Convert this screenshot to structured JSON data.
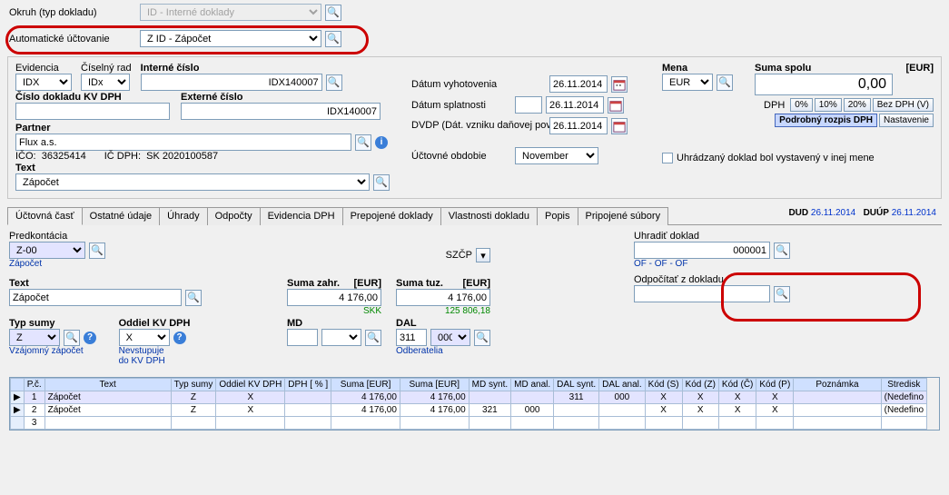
{
  "top": {
    "okruh_label": "Okruh (typ dokladu)",
    "okruh_value": "ID - Interné doklady",
    "auto_uct_label": "Automatické účtovanie",
    "auto_uct_value": "Z ID - Zápočet"
  },
  "header": {
    "evidencia_label": "Evidencia",
    "evidencia_value": "IDX",
    "ciselny_rad_label": "Číselný rad",
    "ciselny_rad_value": "IDx",
    "interne_cislo_label": "Interné číslo",
    "interne_cislo_value": "IDX140007",
    "cislo_dokladu_kvdph_label": "Číslo dokladu KV DPH",
    "cislo_dokladu_kvdph_value": "",
    "externe_cislo_label": "Externé číslo",
    "externe_cislo_value": "IDX140007",
    "partner_label": "Partner",
    "partner_value": "Flux a.s.",
    "ico_label": "IČO:",
    "ico_value": "36325414",
    "icdph_label": "IČ DPH:",
    "icdph_value": "SK 2020100587",
    "text_label": "Text",
    "text_value": "Zápočet",
    "datum_vyhotovenia_label": "Dátum vyhotovenia",
    "datum_vyhotovenia_value": "26.11.2014",
    "datum_splatnosti_label": "Dátum splatnosti",
    "datum_splatnosti_pre": "",
    "datum_splatnosti_value": "26.11.2014",
    "dvdp_label": "DVDP (Dát. vzniku daňovej povinnosti)",
    "dvdp_value": "26.11.2014",
    "uctovne_obdobie_label": "Účtovné obdobie",
    "uctovne_obdobie_value": "November",
    "mena_label": "Mena",
    "mena_value": "EUR",
    "suma_spolu_label": "Suma spolu",
    "suma_spolu_unit": "[EUR]",
    "suma_spolu_value": "0,00",
    "dph_label": "DPH",
    "btn_0": "0%",
    "btn_10": "10%",
    "btn_20": "20%",
    "btn_bezdph": "Bez DPH (V)",
    "btn_podrobny": "Podrobný rozpis DPH",
    "btn_nastavenie": "Nastavenie",
    "uhr_checkbox_label": "Uhrádzaný doklad bol vystavený v inej mene"
  },
  "tabs": {
    "items": [
      "Účtovná časť",
      "Ostatné údaje",
      "Úhrady",
      "Odpočty",
      "Evidencia DPH",
      "Prepojené doklady",
      "Vlastnosti dokladu",
      "Popis",
      "Pripojené súbory"
    ],
    "dud_label": "DUD",
    "dud_value": "26.11.2014",
    "duup_label": "DUÚP",
    "duup_value": "26.11.2014"
  },
  "lower": {
    "predkontacia_label": "Predkontácia",
    "predkontacia_value": "Z-00",
    "predkontacia_sub": "Zápočet",
    "szcp_label": "SZČP",
    "uhradit_label": "Uhradiť doklad",
    "uhradit_value": "000001",
    "uhradit_sub": "OF - OF - OF",
    "odpocitat_label": "Odpočítať z dokladu",
    "odpocitat_value": "",
    "text_label": "Text",
    "text_value": "Zápočet",
    "suma_zahr_label": "Suma zahr.",
    "suma_zahr_unit": "[EUR]",
    "suma_zahr_value": "4 176,00",
    "suma_zahr_sub": "SKK",
    "suma_tuz_label": "Suma tuz.",
    "suma_tuz_unit": "[EUR]",
    "suma_tuz_value": "4 176,00",
    "suma_tuz_sub": "125 806,18",
    "typ_sumy_label": "Typ sumy",
    "typ_sumy_value": "Z",
    "typ_sumy_sub": "Vzájomný zápočet",
    "oddiel_label": "Oddiel KV DPH",
    "oddiel_value": "X",
    "oddiel_sub1": "Nevstupuje",
    "oddiel_sub2": "do KV DPH",
    "md_label": "MD",
    "md_value1": "",
    "md_value2": "",
    "dal_label": "DAL",
    "dal_value1": "311",
    "dal_value2": "000",
    "dal_sub": "Odberatelia"
  },
  "grid": {
    "headers": [
      "P.č.",
      "Text",
      "Typ sumy",
      "Oddiel KV DPH",
      "DPH [ % ]",
      "Suma [EUR]",
      "Suma [EUR]",
      "MD synt.",
      "MD anal.",
      "DAL synt.",
      "DAL anal.",
      "Kód (S)",
      "Kód (Z)",
      "Kód (Č)",
      "Kód (P)",
      "Poznámka",
      "Stredisk"
    ],
    "rows": [
      {
        "pc": "1",
        "text": "Zápočet",
        "typ": "Z",
        "oddiel": "X",
        "dph": "",
        "s1": "4 176,00",
        "s2": "4 176,00",
        "mds": "",
        "mda": "",
        "dals": "311",
        "dala": "000",
        "ks": "X",
        "kz": "X",
        "kc": "X",
        "kp": "X",
        "pozn": "",
        "stred": "(Nedefino"
      },
      {
        "pc": "2",
        "text": "Zápočet",
        "typ": "Z",
        "oddiel": "X",
        "dph": "",
        "s1": "4 176,00",
        "s2": "4 176,00",
        "mds": "321",
        "mda": "000",
        "dals": "",
        "dala": "",
        "ks": "X",
        "kz": "X",
        "kc": "X",
        "kp": "X",
        "pozn": "",
        "stred": "(Nedefino"
      },
      {
        "pc": "3",
        "text": "",
        "typ": "",
        "oddiel": "",
        "dph": "",
        "s1": "",
        "s2": "",
        "mds": "",
        "mda": "",
        "dals": "",
        "dala": "",
        "ks": "",
        "kz": "",
        "kc": "",
        "kp": "",
        "pozn": "",
        "stred": ""
      }
    ]
  }
}
